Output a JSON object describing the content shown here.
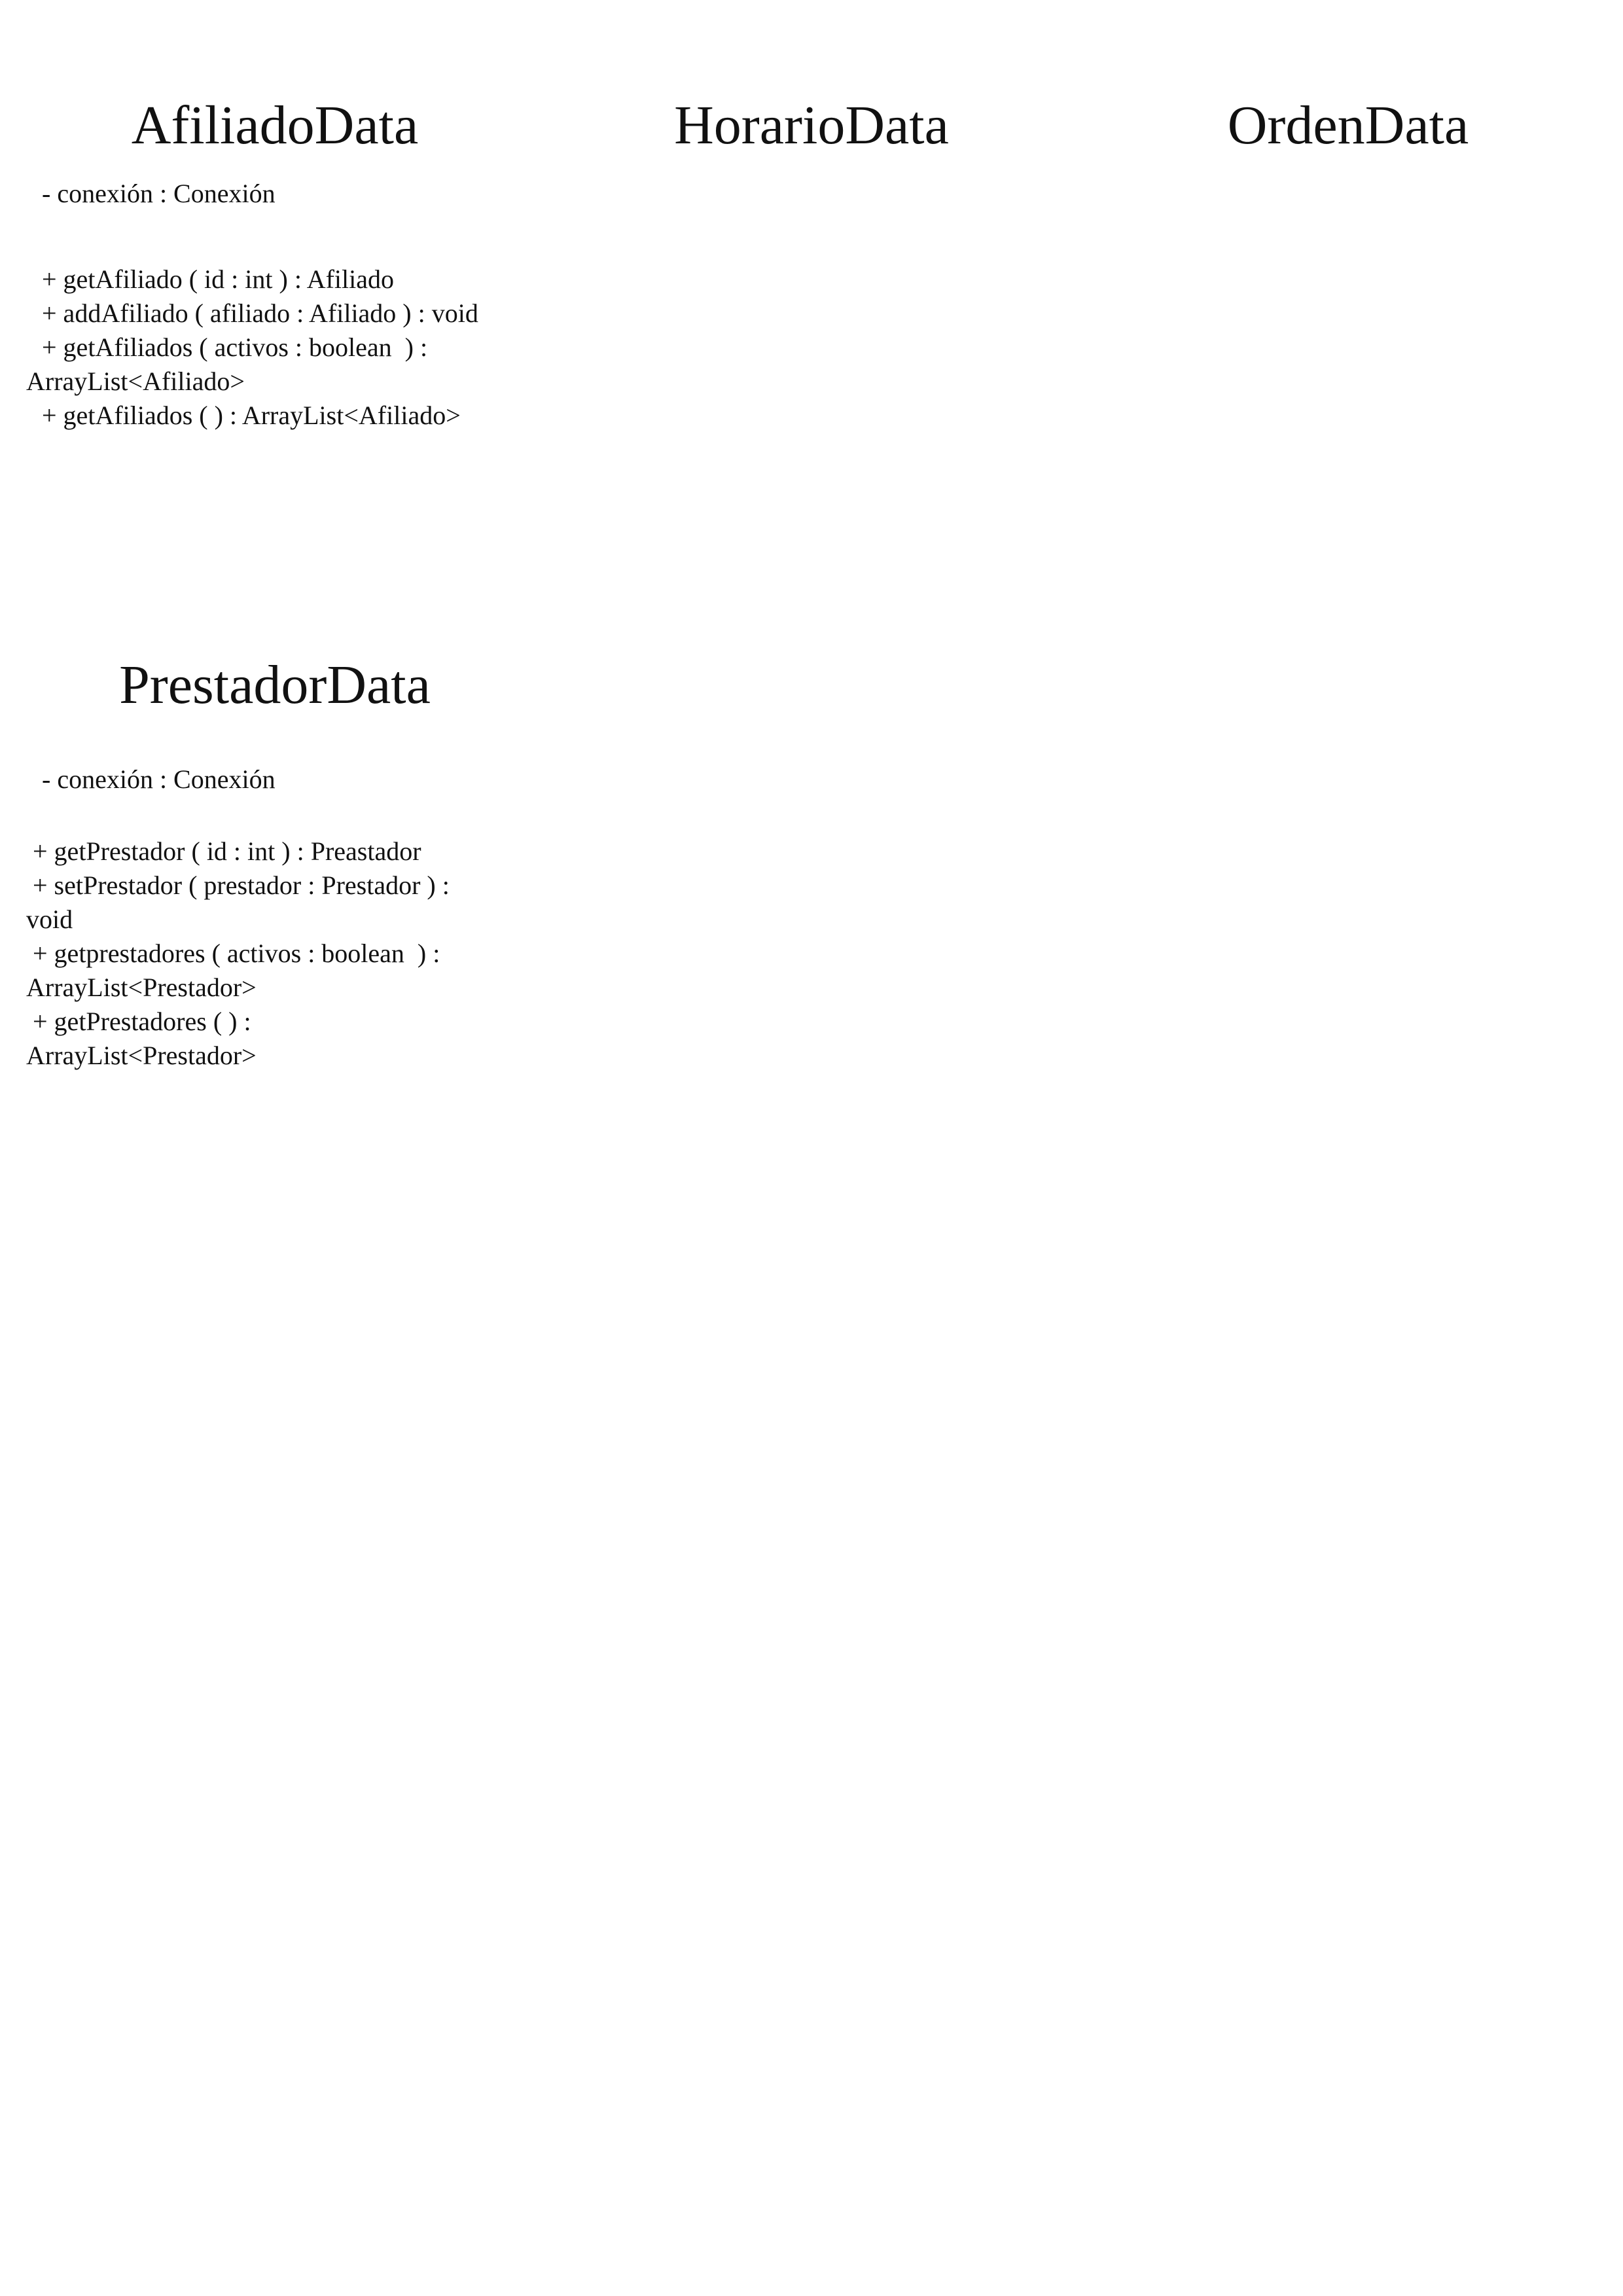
{
  "classes": {
    "afiliado": {
      "name": "AfiliadoData",
      "attributes": [
        " - conexión : Conexión"
      ],
      "methods": [
        " + getAfiliado ( id : int ) : Afiliado",
        " + addAfiliado ( afiliado : Afiliado ) : void",
        " + getAfiliados ( activos : boolean  ) : ArrayList<Afiliado>",
        " + getAfiliados ( ) : ArrayList<Afiliado>"
      ]
    },
    "horario": {
      "name": "HorarioData"
    },
    "orden": {
      "name": "OrdenData"
    },
    "prestador": {
      "name": "PrestadorData",
      "attributes": [
        " - conexión : Conexión"
      ],
      "methods": [
        " + getPrestador ( id : int ) : Preastador",
        " + setPrestador ( prestador : Prestador ) : void",
        " + getprestadores ( activos : boolean  ) : ArrayList<Prestador>",
        " + getPrestadores ( ) : ArrayList<Prestador>"
      ]
    }
  }
}
